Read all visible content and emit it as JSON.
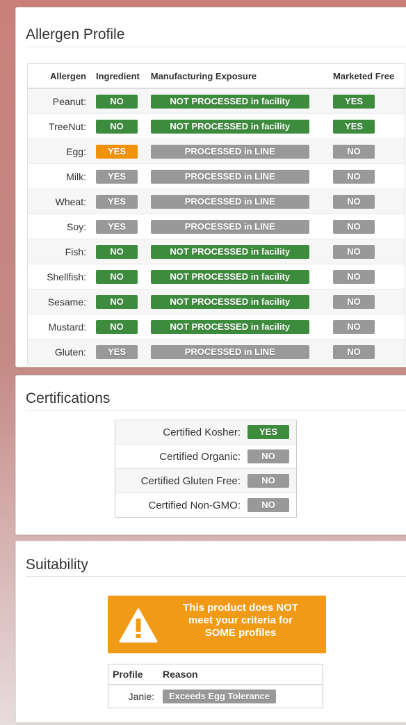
{
  "allergen_panel": {
    "title": "Allergen Profile",
    "headers": [
      "Allergen",
      "Ingredient",
      "Manufacturing Exposure",
      "Marketed Free"
    ],
    "rows": [
      {
        "name": "Peanut:",
        "ingredient": "NO",
        "ingredient_color": "green",
        "mfg": "NOT PROCESSED in facility",
        "mfg_color": "green",
        "marketed": "YES",
        "marketed_color": "green"
      },
      {
        "name": "TreeNut:",
        "ingredient": "NO",
        "ingredient_color": "green",
        "mfg": "NOT PROCESSED in facility",
        "mfg_color": "green",
        "marketed": "YES",
        "marketed_color": "green"
      },
      {
        "name": "Egg:",
        "ingredient": "YES",
        "ingredient_color": "orange",
        "mfg": "PROCESSED in LINE",
        "mfg_color": "gray",
        "marketed": "NO",
        "marketed_color": "gray"
      },
      {
        "name": "Milk:",
        "ingredient": "YES",
        "ingredient_color": "gray",
        "mfg": "PROCESSED in LINE",
        "mfg_color": "gray",
        "marketed": "NO",
        "marketed_color": "gray"
      },
      {
        "name": "Wheat:",
        "ingredient": "YES",
        "ingredient_color": "gray",
        "mfg": "PROCESSED in LINE",
        "mfg_color": "gray",
        "marketed": "NO",
        "marketed_color": "gray"
      },
      {
        "name": "Soy:",
        "ingredient": "YES",
        "ingredient_color": "gray",
        "mfg": "PROCESSED in LINE",
        "mfg_color": "gray",
        "marketed": "NO",
        "marketed_color": "gray"
      },
      {
        "name": "Fish:",
        "ingredient": "NO",
        "ingredient_color": "green",
        "mfg": "NOT PROCESSED in facility",
        "mfg_color": "green",
        "marketed": "NO",
        "marketed_color": "gray"
      },
      {
        "name": "Shellfish:",
        "ingredient": "NO",
        "ingredient_color": "green",
        "mfg": "NOT PROCESSED in facility",
        "mfg_color": "green",
        "marketed": "NO",
        "marketed_color": "gray"
      },
      {
        "name": "Sesame:",
        "ingredient": "NO",
        "ingredient_color": "green",
        "mfg": "NOT PROCESSED in facility",
        "mfg_color": "green",
        "marketed": "NO",
        "marketed_color": "gray"
      },
      {
        "name": "Mustard:",
        "ingredient": "NO",
        "ingredient_color": "green",
        "mfg": "NOT PROCESSED in facility",
        "mfg_color": "green",
        "marketed": "NO",
        "marketed_color": "gray"
      },
      {
        "name": "Gluten:",
        "ingredient": "YES",
        "ingredient_color": "gray",
        "mfg": "PROCESSED in LINE",
        "mfg_color": "gray",
        "marketed": "NO",
        "marketed_color": "gray"
      }
    ]
  },
  "certifications_panel": {
    "title": "Certifications",
    "rows": [
      {
        "label": "Certified Kosher:",
        "value": "YES",
        "color": "green"
      },
      {
        "label": "Certified Organic:",
        "value": "NO",
        "color": "gray"
      },
      {
        "label": "Certified Gluten Free:",
        "value": "NO",
        "color": "gray"
      },
      {
        "label": "Certified Non-GMO:",
        "value": "NO",
        "color": "gray"
      }
    ]
  },
  "suitability_panel": {
    "title": "Suitability",
    "alert_icon": "warning-icon",
    "alert_lines": [
      "This product does NOT",
      "meet your criteria for",
      "SOME profiles"
    ],
    "headers": [
      "Profile",
      "Reason"
    ],
    "rows": [
      {
        "profile": "Janie:",
        "reason": "Exceeds Egg Tolerance",
        "color": "gray"
      }
    ]
  },
  "colors": {
    "green": "#3d8b3d",
    "gray": "#999999",
    "orange": "#f0930b",
    "alert": "#f19a16"
  }
}
